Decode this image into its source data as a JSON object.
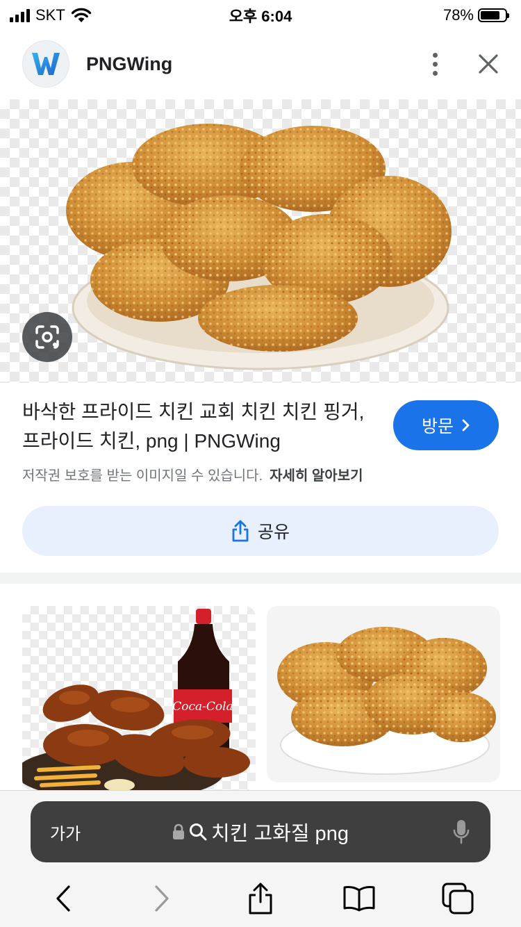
{
  "status_bar": {
    "carrier": "SKT",
    "time": "오후 6:04",
    "battery": "78%",
    "battery_level": 0.78
  },
  "header": {
    "site_name": "PNGWing",
    "logo_letter": "W"
  },
  "result": {
    "title": "바삭한 프라이드 치킨 교회 치킨 치킨 핑거, 프라이드 치킨, png | PNGWing",
    "visit_label": "방문",
    "copyright": "저작권 보호를 받는 이미지일 수 있습니다.",
    "learn_more": "자세히 알아보기",
    "share_label": "공유"
  },
  "related": {
    "card1_logo": "Coca-Cola"
  },
  "browser": {
    "aa_label": "가가",
    "query": "치킨 고화질 png"
  },
  "colors": {
    "accent": "#1a73e8",
    "share_bg": "#e8f0fe",
    "url_bar": "#3f3f3f"
  }
}
